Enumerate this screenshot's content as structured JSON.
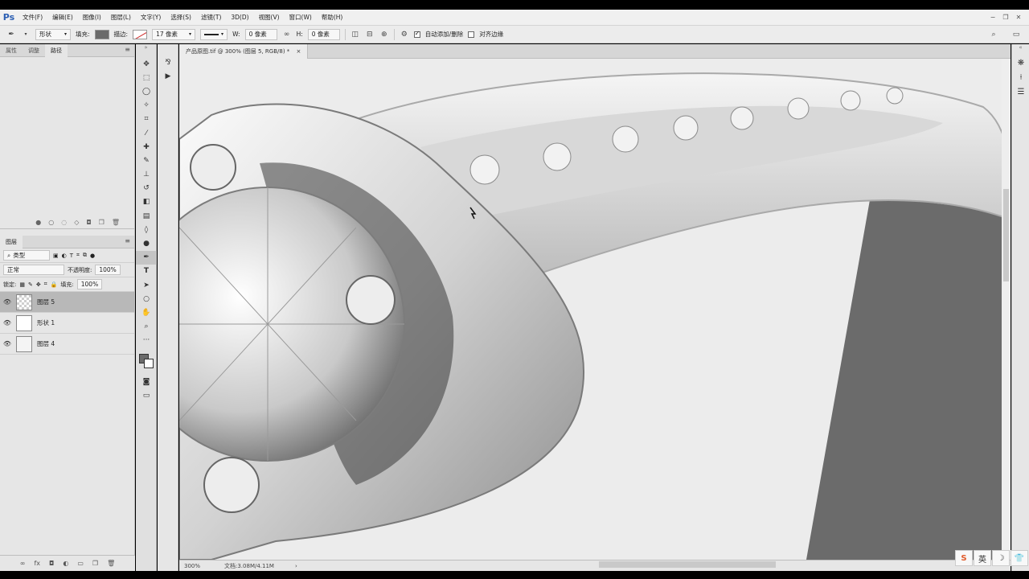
{
  "app": {
    "logo": "Ps"
  },
  "menu": [
    "文件(F)",
    "编辑(E)",
    "图像(I)",
    "图层(L)",
    "文字(Y)",
    "选择(S)",
    "滤镜(T)",
    "3D(D)",
    "视图(V)",
    "窗口(W)",
    "帮助(H)"
  ],
  "window_controls": {
    "minimize": "−",
    "restore": "❐",
    "close": "✕"
  },
  "options": {
    "mode": "形状",
    "fill_label": "填充:",
    "stroke_label": "描边:",
    "stroke_size": "17 像素",
    "w_label": "W:",
    "w_value": "0 像素",
    "h_label": "H:",
    "h_value": "0 像素",
    "auto_add_delete": "自动添加/删除",
    "align_edges": "对齐边缘"
  },
  "left_panel": {
    "tabs": [
      "属性",
      "调整",
      "路径"
    ],
    "active_tab": "路径",
    "layers_tab": "图层",
    "filter_kind": "类型",
    "blend_mode": "正常",
    "opacity_label": "不透明度:",
    "opacity_value": "100%",
    "lock_label": "锁定:",
    "fill_label": "填充:",
    "fill_value": "100%",
    "layers": [
      {
        "name": "图层 5",
        "selected": true
      },
      {
        "name": "形状 1",
        "selected": false
      },
      {
        "name": "图层 4",
        "selected": false
      }
    ]
  },
  "document": {
    "tab_title": "产品原图.tif @ 300% (图层 5, RGB/8) *",
    "zoom": "300%",
    "doc_info": "文档:3.08M/4.11M"
  },
  "ime": {
    "lang": "英",
    "brand": "S"
  },
  "colors": {
    "accent": "#2c5fb3",
    "canvas_bg": "#eaeaea",
    "shape_fill": "#6b6b6b"
  },
  "icons": {
    "tools": [
      "move-icon",
      "marquee-icon",
      "lasso-icon",
      "magic-wand-icon",
      "crop-icon",
      "eyedropper-icon",
      "healing-icon",
      "brush-icon",
      "stamp-icon",
      "history-brush-icon",
      "eraser-icon",
      "gradient-icon",
      "blur-icon",
      "dodge-icon",
      "pen-icon",
      "type-icon",
      "path-select-icon",
      "ellipse-icon",
      "hand-icon",
      "zoom-icon",
      "more-icon"
    ]
  }
}
